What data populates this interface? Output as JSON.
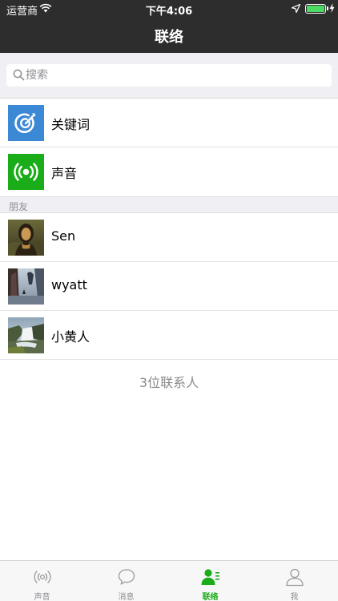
{
  "status_bar": {
    "carrier": "运营商",
    "time": "下午4:06",
    "battery_level": 1.0
  },
  "nav": {
    "title": "联络"
  },
  "search": {
    "placeholder": "搜索",
    "value": ""
  },
  "feature_items": [
    {
      "label": "关键词",
      "icon": "target-icon",
      "color": "#3b89d4"
    },
    {
      "label": "声音",
      "icon": "broadcast-icon",
      "color": "#1aad19"
    }
  ],
  "friends_section": {
    "header": "朋友"
  },
  "friends": [
    {
      "name": "Sen",
      "avatar": "portrait-avatar"
    },
    {
      "name": "wyatt",
      "avatar": "landscape-avatar"
    },
    {
      "name": "小黄人",
      "avatar": "waterfall-avatar"
    }
  ],
  "contact_count": "3位联系人",
  "tabs": [
    {
      "label": "声音",
      "icon": "broadcast-icon",
      "active": false
    },
    {
      "label": "消息",
      "icon": "chat-bubble-icon",
      "active": false
    },
    {
      "label": "联络",
      "icon": "contacts-icon",
      "active": true
    },
    {
      "label": "我",
      "icon": "person-icon",
      "active": false
    }
  ],
  "colors": {
    "nav_bg": "#2d2d2d",
    "accent_green": "#1aad19",
    "accent_blue": "#3b89d4",
    "background_gray": "#efeff4"
  }
}
